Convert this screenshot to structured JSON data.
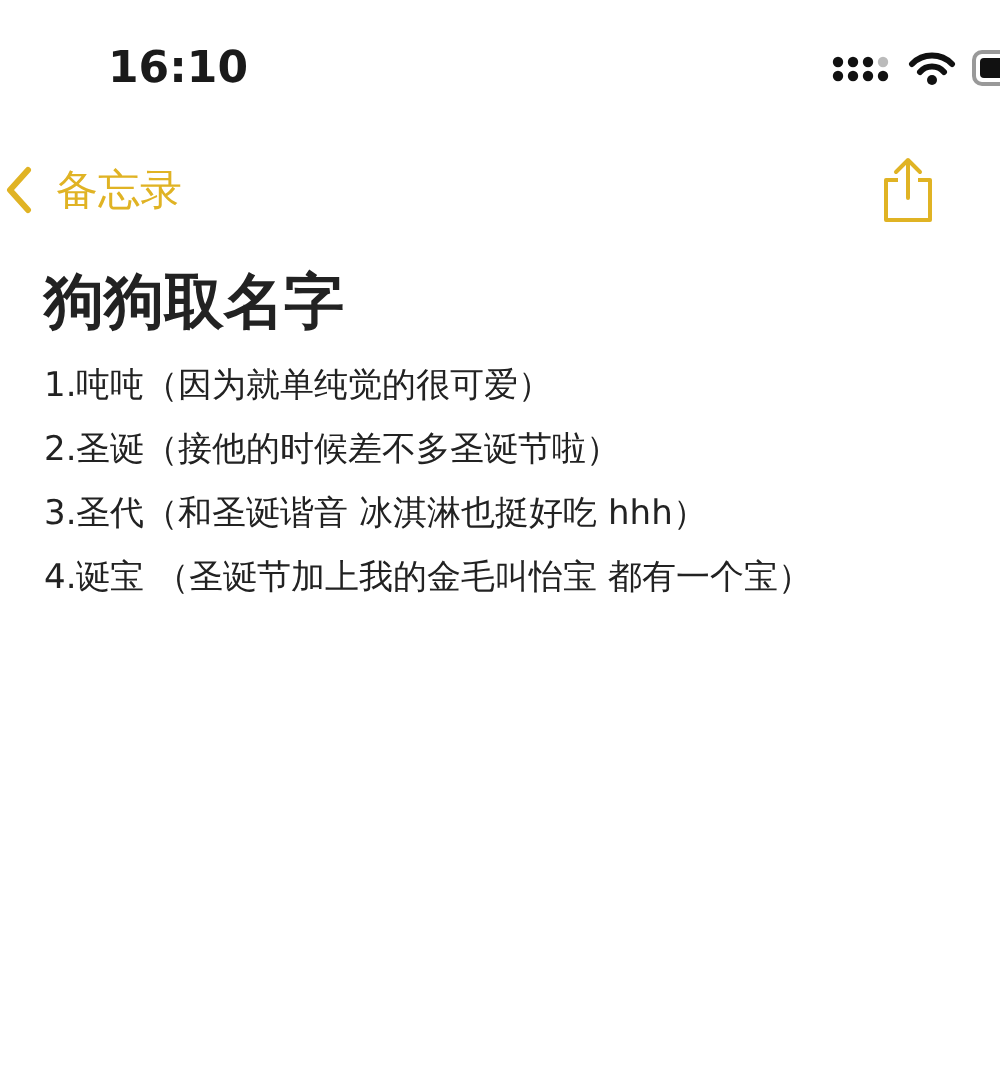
{
  "status_bar": {
    "time": "16:10"
  },
  "nav": {
    "back_label": "备忘录"
  },
  "note": {
    "title": "狗狗取名字",
    "lines": [
      "1.吨吨（因为就单纯觉的很可爱）",
      "2.圣诞（接他的时候差不多圣诞节啦）",
      "3.圣代（和圣诞谐音 冰淇淋也挺好吃 hhh）",
      "4.诞宝 （圣诞节加上我的金毛叫怡宝 都有一个宝）"
    ]
  }
}
